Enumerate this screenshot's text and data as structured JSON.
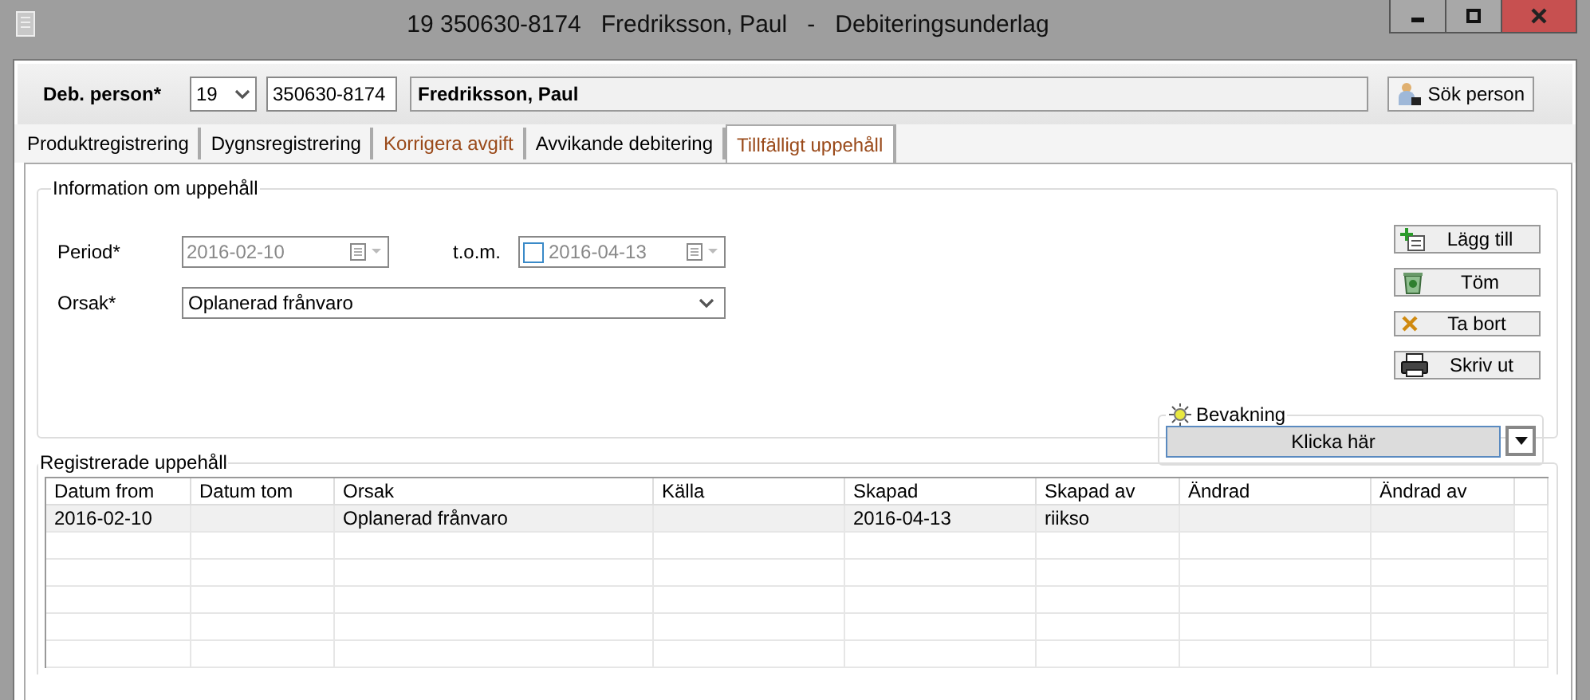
{
  "window": {
    "title": "19 350630-8174   Fredriksson, Paul   -   Debiteringsunderlag"
  },
  "person": {
    "label": "Deb. person*",
    "century": "19",
    "id": "350630-8174",
    "name": "Fredriksson, Paul",
    "search_button": "Sök person"
  },
  "tabs": [
    {
      "label": "Produktregistrering",
      "selected": false,
      "marked": false
    },
    {
      "label": "Dygnsregistrering",
      "selected": false,
      "marked": false
    },
    {
      "label": "Korrigera avgift",
      "selected": false,
      "marked": true
    },
    {
      "label": "Avvikande debitering",
      "selected": false,
      "marked": false
    },
    {
      "label": "Tillfälligt uppehåll",
      "selected": true,
      "marked": true
    }
  ],
  "info_group": {
    "title": "Information om uppehåll",
    "period": {
      "label": "Period*",
      "from": {
        "value": "2016-02-10",
        "disabled": true
      },
      "to_label": "t.o.m.",
      "to": {
        "value": "2016-04-13",
        "checked": false
      }
    },
    "reason": {
      "label": "Orsak*",
      "value": "Oplanerad frånvaro"
    }
  },
  "actions": [
    {
      "label": "Lägg till",
      "kind": "add"
    },
    {
      "label": "Töm",
      "kind": "clear"
    },
    {
      "label": "Ta bort",
      "kind": "remove"
    },
    {
      "label": "Skriv ut",
      "kind": "print"
    }
  ],
  "watch": {
    "title": "Bevakning",
    "button": "Klicka här"
  },
  "table": {
    "title": "Registrerade uppehåll",
    "columns": [
      "Datum from",
      "Datum tom",
      "Orsak",
      "Källa",
      "Skapad",
      "Skapad av",
      "Ändrad",
      "Ändrad av"
    ],
    "rows": [
      {
        "selected": true,
        "cells": [
          "2016-02-10",
          null,
          "Oplanerad frånvaro",
          null,
          "2016-04-13",
          "riikso",
          null,
          null
        ]
      }
    ]
  }
}
